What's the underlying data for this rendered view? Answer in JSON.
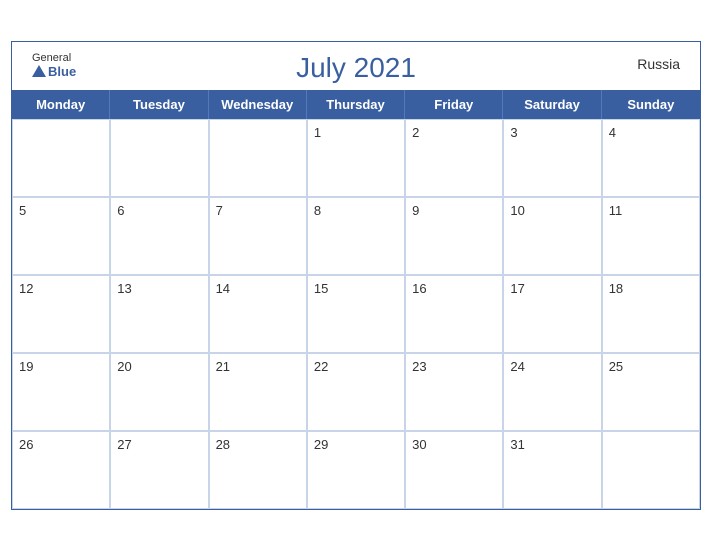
{
  "header": {
    "title": "July 2021",
    "country": "Russia",
    "logo_general": "General",
    "logo_blue": "Blue"
  },
  "days": [
    "Monday",
    "Tuesday",
    "Wednesday",
    "Thursday",
    "Friday",
    "Saturday",
    "Sunday"
  ],
  "weeks": [
    [
      null,
      null,
      null,
      1,
      2,
      3,
      4
    ],
    [
      5,
      6,
      7,
      8,
      9,
      10,
      11
    ],
    [
      12,
      13,
      14,
      15,
      16,
      17,
      18
    ],
    [
      19,
      20,
      21,
      22,
      23,
      24,
      25
    ],
    [
      26,
      27,
      28,
      29,
      30,
      31,
      null
    ]
  ]
}
